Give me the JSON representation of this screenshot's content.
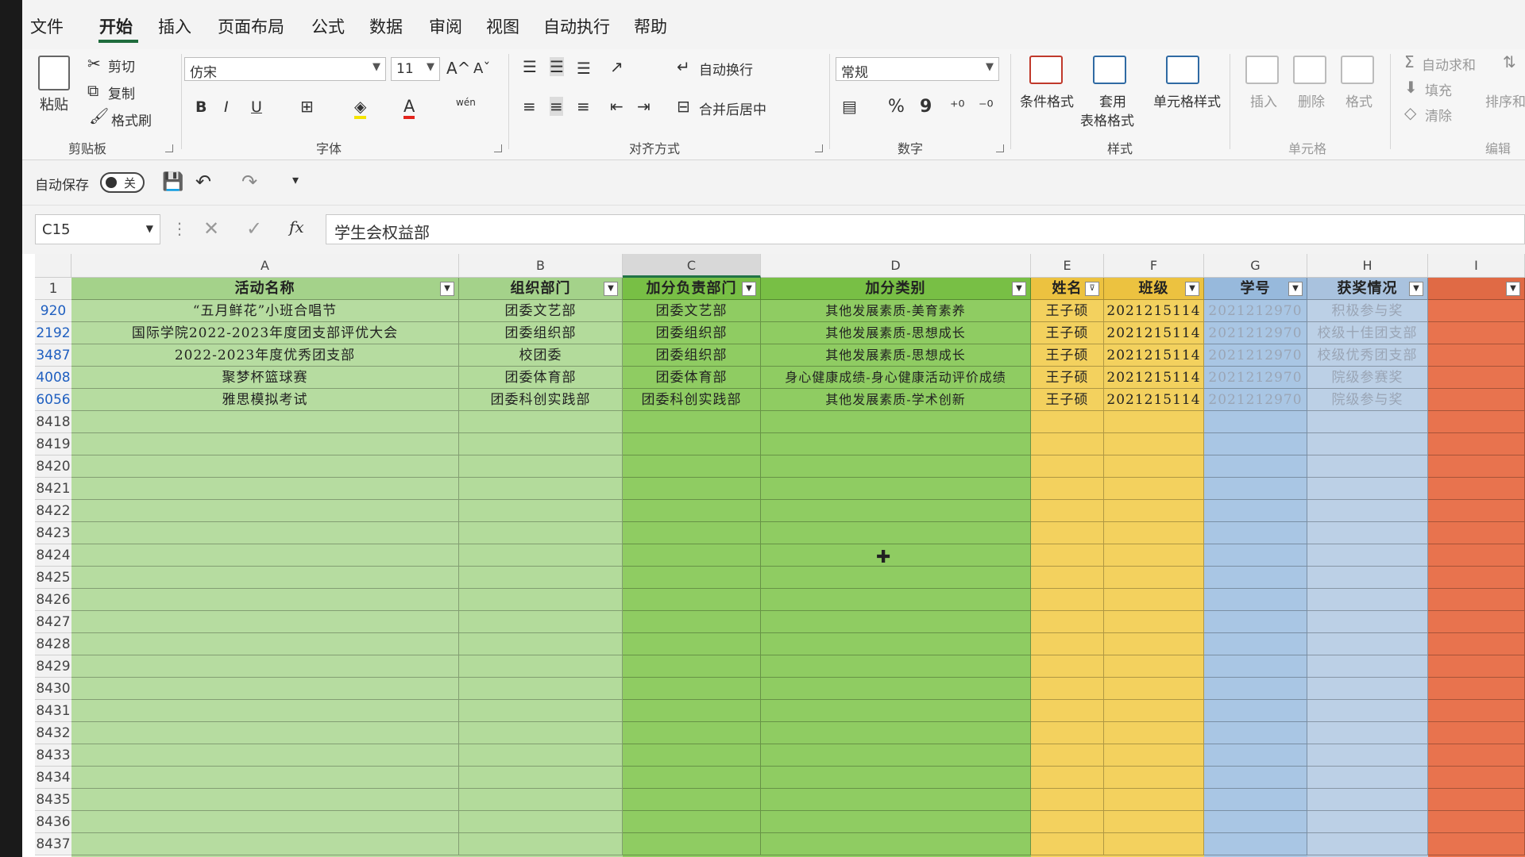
{
  "menu": [
    "文件",
    "开始",
    "插入",
    "页面布局",
    "公式",
    "数据",
    "审阅",
    "视图",
    "自动执行",
    "帮助"
  ],
  "ribbon": {
    "clipboard": {
      "paste": "粘贴",
      "cut": "剪切",
      "copy": "复制",
      "format_painter": "格式刷",
      "group": "剪贴板"
    },
    "font": {
      "name": "仿宋",
      "size": "11",
      "bold": "B",
      "italic": "I",
      "underline": "U",
      "grow": "A^",
      "shrink": "Aˇ",
      "color_a": "A",
      "wen": "wén",
      "group": "字体"
    },
    "alignment": {
      "wrap": "自动换行",
      "merge": "合并后居中",
      "group": "对齐方式"
    },
    "number": {
      "format": "常规",
      "percent": "%",
      "comma": "9",
      "group": "数字"
    },
    "styles": {
      "cond": "条件格式",
      "table1": "套用",
      "table2": "表格格式",
      "cell_styles": "单元格样式",
      "group": "样式"
    },
    "cells": {
      "insert": "插入",
      "delete": "删除",
      "format": "格式",
      "group": "单元格"
    },
    "editing": {
      "autosum": "自动求和",
      "fill": "填充",
      "clear": "清除",
      "sort": "排序和",
      "group": "编辑"
    }
  },
  "qat": {
    "autosave": "自动保存",
    "toggle": "关"
  },
  "formula_bar": {
    "cell_ref": "C15",
    "fx": "fx",
    "value": "学生会权益部"
  },
  "columns": [
    "A",
    "B",
    "C",
    "D",
    "E",
    "F",
    "G",
    "H",
    "I"
  ],
  "header_row": {
    "num": "1",
    "cells": [
      "活动名称",
      "组织部门",
      "加分负责部门",
      "加分类别",
      "姓名",
      "班级",
      "学号",
      "获奖情况",
      ""
    ]
  },
  "rows": [
    {
      "num": "920",
      "cells": [
        "“五月鲜花”小班合唱节",
        "团委文艺部",
        "团委文艺部",
        "其他发展素质-美育素养",
        "王子硕",
        "2021215114",
        "2021212970",
        "积极参与奖"
      ]
    },
    {
      "num": "2192",
      "cells": [
        "国际学院2022-2023年度团支部评优大会",
        "团委组织部",
        "团委组织部",
        "其他发展素质-思想成长",
        "王子硕",
        "2021215114",
        "2021212970",
        "校级十佳团支部"
      ]
    },
    {
      "num": "3487",
      "cells": [
        "2022-2023年度优秀团支部",
        "校团委",
        "团委组织部",
        "其他发展素质-思想成长",
        "王子硕",
        "2021215114",
        "2021212970",
        "校级优秀团支部"
      ]
    },
    {
      "num": "4008",
      "cells": [
        "聚梦杯篮球赛",
        "团委体育部",
        "团委体育部",
        "身心健康成绩-身心健康活动评价成绩",
        "王子硕",
        "2021215114",
        "2021212970",
        "院级参赛奖"
      ]
    },
    {
      "num": "6056",
      "cells": [
        "雅思模拟考试",
        "团委科创实践部",
        "团委科创实践部",
        "其他发展素质-学术创新",
        "王子硕",
        "2021215114",
        "2021212970",
        "院级参与奖"
      ]
    }
  ],
  "empty_rows": [
    "8418",
    "8419",
    "8420",
    "8421",
    "8422",
    "8423",
    "8424",
    "8425",
    "8426",
    "8427",
    "8428",
    "8429",
    "8430",
    "8431",
    "8432",
    "8433",
    "8434",
    "8435",
    "8436",
    "8437"
  ]
}
